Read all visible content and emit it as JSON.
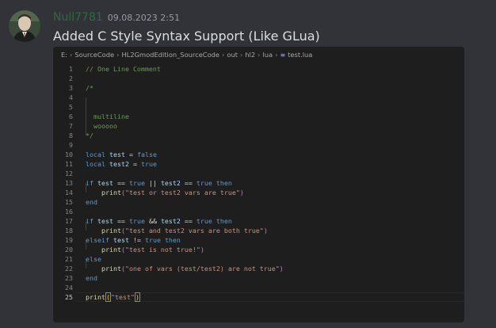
{
  "message": {
    "username": "Null7781",
    "timestamp": "09.08.2023 2:51",
    "text": "Added C Style Syntax Support (Like GLua)"
  },
  "breadcrumb": {
    "parts": [
      "E:",
      "SourceCode",
      "HL2GmodEdition_SourceCode",
      "out",
      "hl2",
      "lua"
    ],
    "file_icon": "file-lines-icon",
    "file": "test.lua"
  },
  "code": {
    "active_line": 25,
    "lines": [
      {
        "n": "1",
        "tokens": [
          [
            "cmt",
            "// One Line Comment"
          ]
        ]
      },
      {
        "n": "2",
        "tokens": []
      },
      {
        "n": "3",
        "tokens": [
          [
            "cmt",
            "/*"
          ]
        ]
      },
      {
        "n": "4",
        "tokens": []
      },
      {
        "n": "5",
        "tokens": []
      },
      {
        "n": "6",
        "tokens": [
          [
            "cmt",
            "  multiline"
          ]
        ]
      },
      {
        "n": "7",
        "tokens": [
          [
            "cmt",
            "  wooooo"
          ]
        ]
      },
      {
        "n": "8",
        "tokens": [
          [
            "cmt",
            "*/"
          ]
        ]
      },
      {
        "n": "9",
        "tokens": []
      },
      {
        "n": "10",
        "tokens": [
          [
            "kw",
            "local"
          ],
          [
            "plain",
            " "
          ],
          [
            "var",
            "test"
          ],
          [
            "op",
            " = "
          ],
          [
            "kw",
            "false"
          ]
        ]
      },
      {
        "n": "11",
        "tokens": [
          [
            "kw",
            "local"
          ],
          [
            "plain",
            " "
          ],
          [
            "var",
            "test2"
          ],
          [
            "op",
            " = "
          ],
          [
            "kw",
            "true"
          ]
        ]
      },
      {
        "n": "12",
        "tokens": []
      },
      {
        "n": "13",
        "tokens": [
          [
            "kw",
            "if"
          ],
          [
            "plain",
            " "
          ],
          [
            "var",
            "test"
          ],
          [
            "op",
            " == "
          ],
          [
            "kw",
            "true"
          ],
          [
            "op",
            " || "
          ],
          [
            "var",
            "test2"
          ],
          [
            "op",
            " == "
          ],
          [
            "kw",
            "true"
          ],
          [
            "plain",
            " "
          ],
          [
            "kw",
            "then"
          ]
        ]
      },
      {
        "n": "14",
        "tokens": [
          [
            "plain",
            "    "
          ],
          [
            "fn",
            "print"
          ],
          [
            "br",
            "("
          ],
          [
            "str",
            "\"test or test2 vars are true\""
          ],
          [
            "br",
            ")"
          ]
        ]
      },
      {
        "n": "15",
        "tokens": [
          [
            "kw",
            "end"
          ]
        ]
      },
      {
        "n": "16",
        "tokens": []
      },
      {
        "n": "17",
        "tokens": [
          [
            "kw",
            "if"
          ],
          [
            "plain",
            " "
          ],
          [
            "var",
            "test"
          ],
          [
            "op",
            " == "
          ],
          [
            "kw",
            "true"
          ],
          [
            "op",
            " && "
          ],
          [
            "var",
            "test2"
          ],
          [
            "op",
            " == "
          ],
          [
            "kw",
            "true"
          ],
          [
            "plain",
            " "
          ],
          [
            "kw",
            "then"
          ]
        ]
      },
      {
        "n": "18",
        "tokens": [
          [
            "plain",
            "    "
          ],
          [
            "fn",
            "print"
          ],
          [
            "br",
            "("
          ],
          [
            "str",
            "\"test and test2 vars are both true\""
          ],
          [
            "br",
            ")"
          ]
        ]
      },
      {
        "n": "19",
        "tokens": [
          [
            "kw",
            "elseif"
          ],
          [
            "plain",
            " "
          ],
          [
            "var",
            "test"
          ],
          [
            "op",
            " != "
          ],
          [
            "kw",
            "true"
          ],
          [
            "plain",
            " "
          ],
          [
            "kw",
            "then"
          ]
        ]
      },
      {
        "n": "20",
        "tokens": [
          [
            "plain",
            "    "
          ],
          [
            "fn",
            "print"
          ],
          [
            "br",
            "("
          ],
          [
            "str",
            "\"test is not true!\""
          ],
          [
            "br",
            ")"
          ]
        ]
      },
      {
        "n": "21",
        "tokens": [
          [
            "kw",
            "else"
          ]
        ]
      },
      {
        "n": "22",
        "tokens": [
          [
            "plain",
            "    "
          ],
          [
            "fn",
            "print"
          ],
          [
            "br",
            "("
          ],
          [
            "str",
            "\"one of vars (test/test2) are not true\""
          ],
          [
            "br",
            ")"
          ]
        ]
      },
      {
        "n": "23",
        "tokens": [
          [
            "kw",
            "end"
          ]
        ]
      },
      {
        "n": "24",
        "tokens": []
      },
      {
        "n": "25",
        "tokens": [
          [
            "fn",
            "print"
          ],
          [
            "br2",
            "("
          ],
          [
            "str",
            "\"test\""
          ],
          [
            "br2",
            ")"
          ]
        ]
      }
    ]
  }
}
